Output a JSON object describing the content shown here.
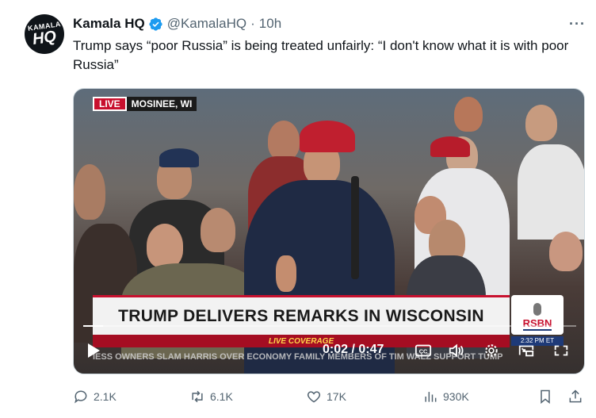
{
  "tweet": {
    "author_name": "Kamala HQ",
    "handle": "@KamalaHQ",
    "separator": "·",
    "time": "10h",
    "avatar_text_top": "KAMALA",
    "avatar_text_bottom": "HQ",
    "text": "Trump says “poor Russia” is being treated unfairly: “I don't know what it is with poor Russia”",
    "more_label": "···"
  },
  "video": {
    "live_label": "LIVE",
    "location": "MOSINEE, WI",
    "headline": "TRUMP DELIVERS REMARKS IN WISCONSIN",
    "coverage_label": "LIVE COVERAGE",
    "ticker": "IESS OWNERS SLAM HARRIS OVER ECONOMY     FAMILY MEMBERS OF TIM WALZ SUPPORT TUMP",
    "network_logo": "RSBN",
    "network_time": "2:32 PM ET",
    "elapsed": "0:02",
    "duration": "0:47",
    "time_display": "0:02 / 0:47",
    "progress_fraction": 0.04
  },
  "actions": {
    "replies": "2.1K",
    "reposts": "6.1K",
    "likes": "17K",
    "views": "930K"
  },
  "colors": {
    "verified_blue": "#1d9bf0",
    "text_secondary": "#536471",
    "live_red": "#c8102e"
  }
}
